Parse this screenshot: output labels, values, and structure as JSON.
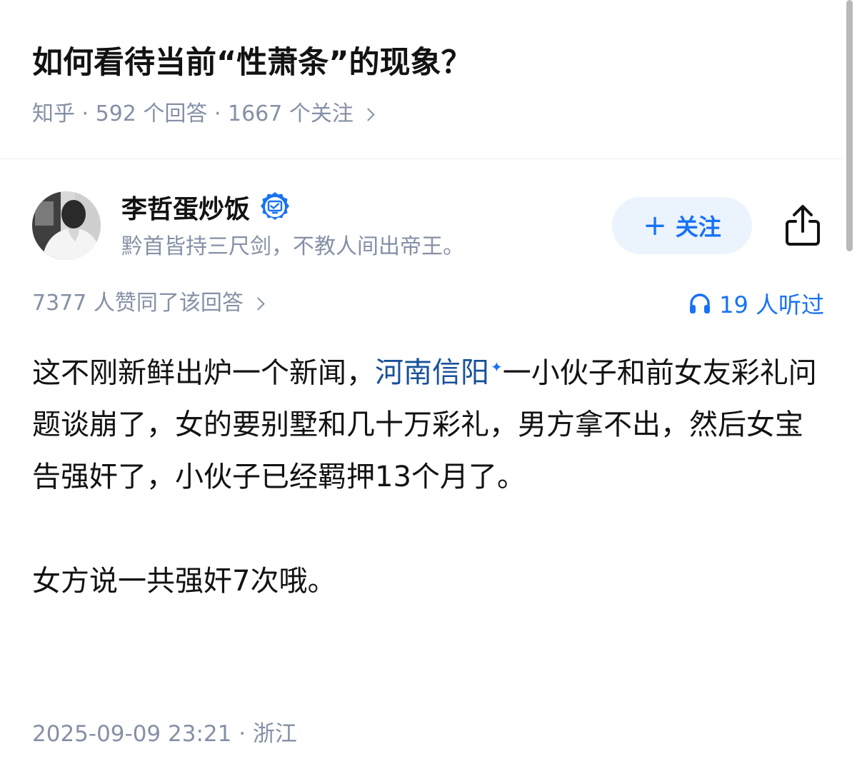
{
  "question": {
    "title": "如何看待当前“性萧条”的现象？",
    "meta_text": "知乎 · 592 个回答 · 1667 个关注"
  },
  "author": {
    "name": "李哲蛋炒饭",
    "headline": "黔首皆持三尺剑，不教人间出帝王。",
    "follow_label": "关注",
    "follow_plus": "+",
    "badge_color": "#1772f6"
  },
  "answer": {
    "vote_summary": "7377 人赞同了该回答",
    "listen_count": "19 人听过",
    "para1_before": "这不刚新鲜出炉一个新闻，",
    "para1_link": "河南信阳",
    "para1_after": "一小伙子和前女友彩礼问题谈崩了，女的要别墅和几十万彩礼，男方拿不出，然后女宝告强奸了，小伙子已经羁押13个月了。",
    "para2": "女方说一共强奸7次哦。",
    "footer": "2025-09-09 23:21 · 浙江"
  },
  "colors": {
    "accent": "#1772f6",
    "link": "#175199",
    "muted": "#8590a6",
    "text": "#121212",
    "follow_bg": "#ebf3fd"
  }
}
